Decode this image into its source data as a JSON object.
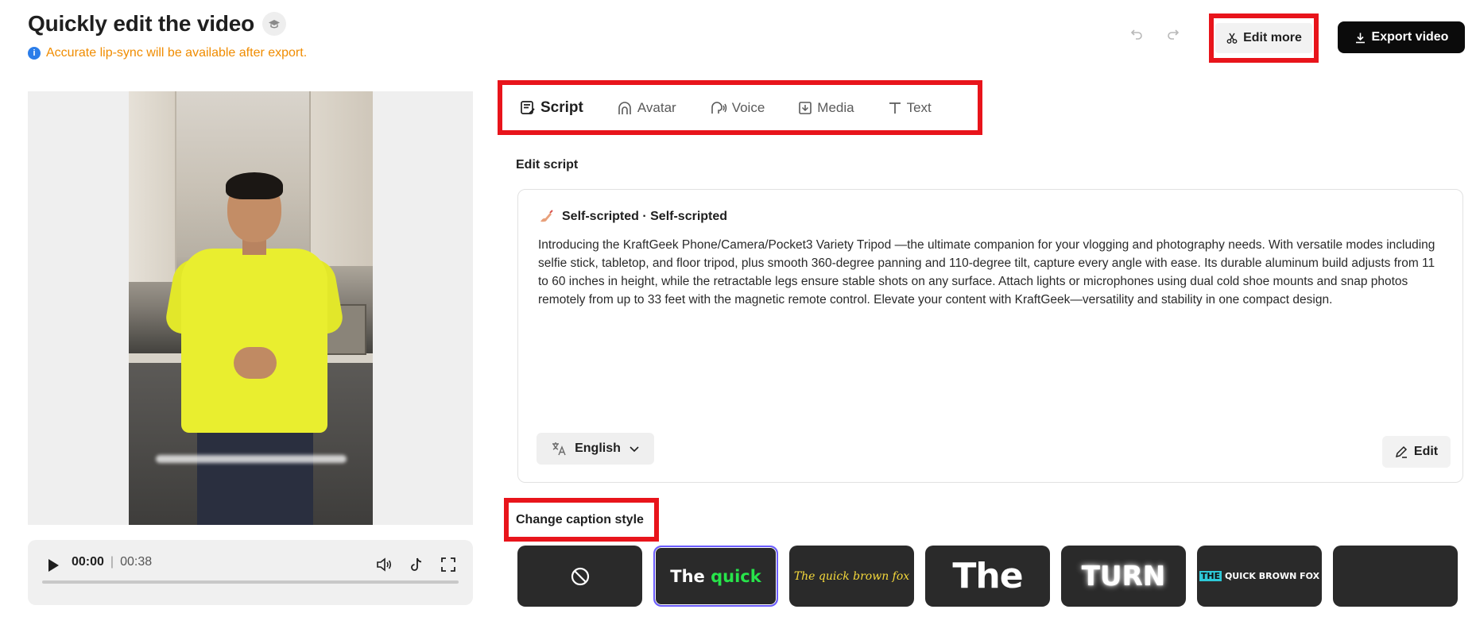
{
  "header": {
    "title": "Quickly edit the video",
    "notice": "Accurate lip-sync will be available after export.",
    "edit_more_label": "Edit more",
    "export_label": "Export video"
  },
  "player": {
    "current_time": "00:00",
    "separator": "|",
    "total_time": "00:38",
    "progress": 0
  },
  "tabs": [
    {
      "label": "Script",
      "icon": "script-icon",
      "active": true
    },
    {
      "label": "Avatar",
      "icon": "avatar-icon",
      "active": false
    },
    {
      "label": "Voice",
      "icon": "voice-icon",
      "active": false
    },
    {
      "label": "Media",
      "icon": "media-icon",
      "active": false
    },
    {
      "label": "Text",
      "icon": "text-icon",
      "active": false
    }
  ],
  "script": {
    "section_label": "Edit script",
    "header": "Self-scripted · Self-scripted",
    "body": "Introducing the KraftGeek Phone/Camera/Pocket3 Variety Tripod —the ultimate companion for your vlogging and photography needs. With versatile modes including selfie stick, tabletop, and floor tripod, plus smooth 360-degree panning and 110-degree tilt, capture every angle with ease. Its durable aluminum build adjusts from 11 to 60 inches in height, while the retractable legs ensure stable shots on any surface. Attach lights or microphones using dual cold shoe mounts and snap photos remotely from up to 33 feet with the magnetic remote control. Elevate your content with KraftGeek—versatility and stability in one compact design.",
    "language": "English",
    "edit_label": "Edit"
  },
  "captions": {
    "title": "Change caption style",
    "styles": [
      {
        "name": "none",
        "icon": "no-caption-icon"
      },
      {
        "name": "quick-green",
        "text_a": "The",
        "text_b": "quick"
      },
      {
        "name": "brown-fox-italic",
        "text": "The quick brown fox"
      },
      {
        "name": "big-the",
        "text": "The"
      },
      {
        "name": "glow-turn",
        "text": "TURN"
      },
      {
        "name": "highlight-fox",
        "text_a": "THE",
        "text_b": " QUICK BROWN FOX"
      },
      {
        "name": "blank"
      }
    ]
  },
  "colors": {
    "highlight_red": "#e8141b",
    "notice_orange": "#f08c00",
    "export_bg": "#0b0b0b",
    "selected_outline": "#6b5cff"
  }
}
